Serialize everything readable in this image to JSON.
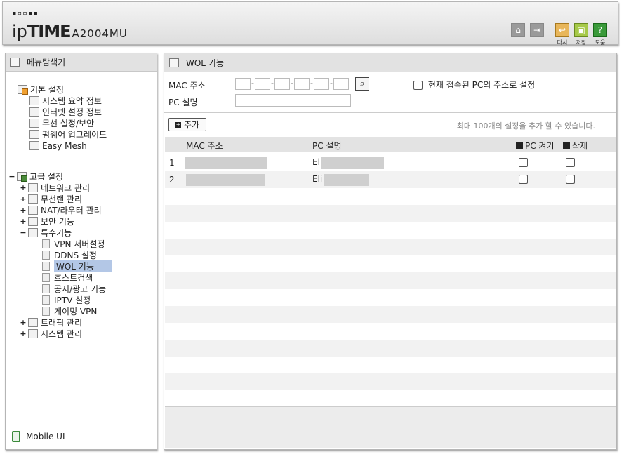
{
  "header": {
    "logo_dots": "▪▫▫▪▪",
    "brand_prefix": "ip",
    "brand_main": "TIME",
    "model": "A2004MU",
    "buttons": [
      {
        "icon": "home-icon"
      },
      {
        "icon": "logout-icon"
      },
      {
        "icon": "refresh-icon",
        "label": "다시"
      },
      {
        "icon": "save-icon",
        "label": "저장"
      },
      {
        "icon": "help-icon",
        "label": "도움"
      }
    ]
  },
  "sidebar": {
    "title": "메뉴탐색기",
    "mobile_label": "Mobile UI",
    "basic": {
      "label": "기본 설정",
      "items": [
        "시스템 요약 정보",
        "인터넷 설정 정보",
        "무선 설정/보안",
        "펌웨어 업그레이드",
        "Easy Mesh"
      ]
    },
    "advanced": {
      "label": "고급 설정",
      "items": [
        "네트워크 관리",
        "무선랜 관리",
        "NAT/라우터 관리",
        "보안 기능",
        "특수기능"
      ],
      "special_items": [
        "VPN 서버설정",
        "DDNS 설정",
        "WOL 기능",
        "호스트검색",
        "공지/광고 기능",
        "IPTV 설정",
        "게이밍 VPN"
      ],
      "after_items": [
        "트래픽 관리",
        "시스템 관리"
      ]
    }
  },
  "main": {
    "title": "WOL 기능",
    "mac_label": "MAC 주소",
    "desc_label": "PC 설명",
    "current_pc_label": "현재 접속된 PC의 주소로 설정",
    "add_button": "추가",
    "limit_note": "최대 100개의 설정을 추가 할 수 있습니다.",
    "columns": {
      "mac": "MAC 주소",
      "desc": "PC 설명",
      "wake": "PC 켜기",
      "delete": "삭제"
    },
    "rows": [
      {
        "num": "1",
        "desc": "El"
      },
      {
        "num": "2",
        "desc": "Eli"
      }
    ]
  }
}
